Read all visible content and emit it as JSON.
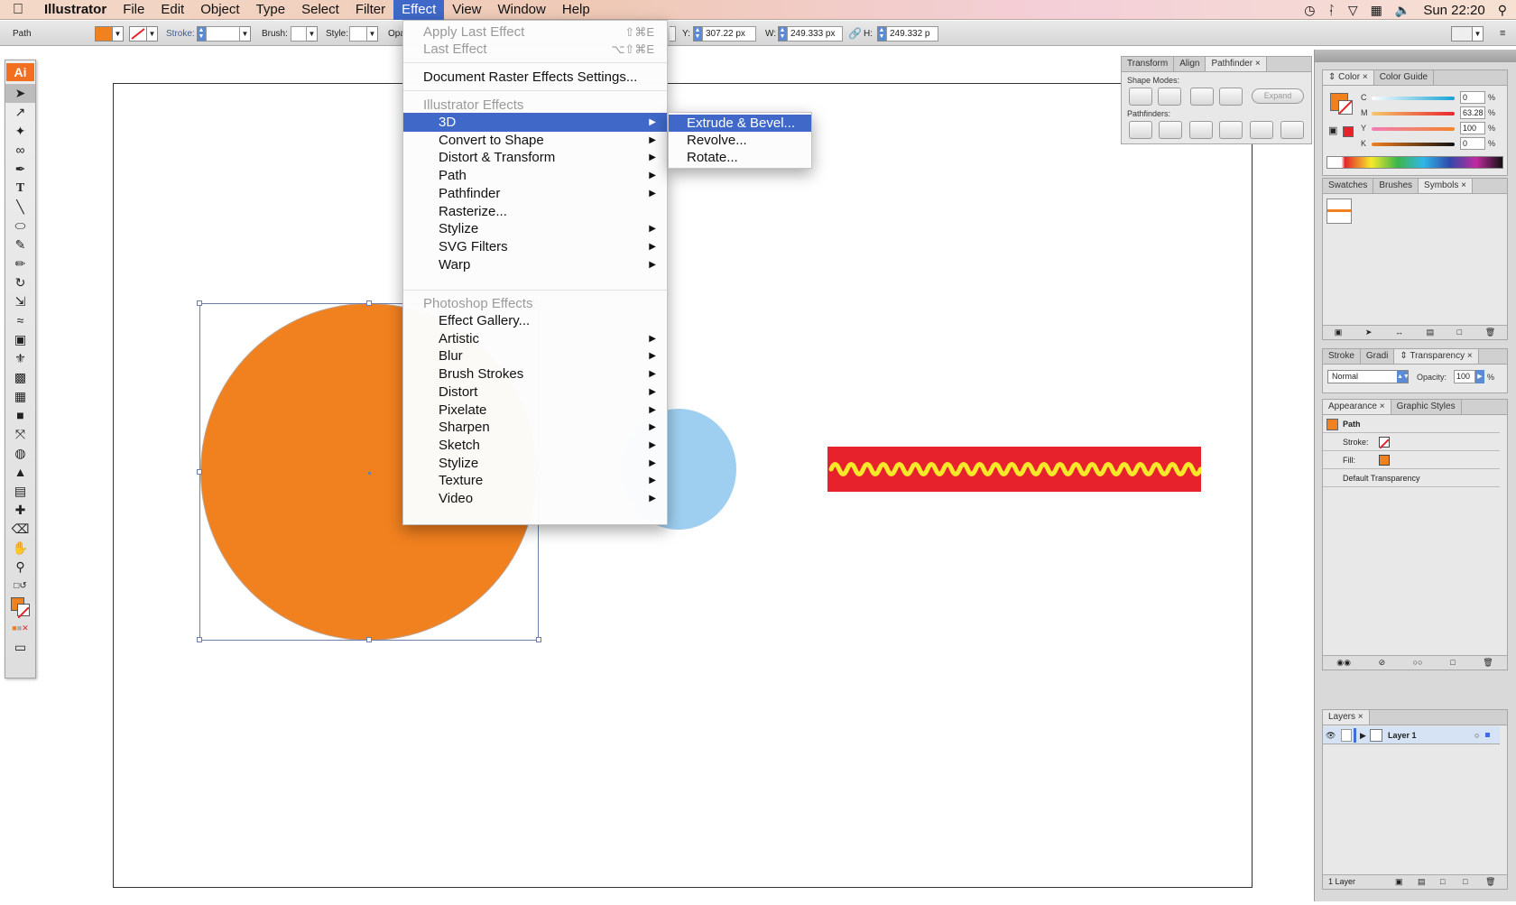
{
  "menubar": {
    "app_name": "Illustrator",
    "items": [
      "File",
      "Edit",
      "Object",
      "Type",
      "Select",
      "Filter",
      "Effect",
      "View",
      "Window",
      "Help"
    ],
    "active": "Effect",
    "clock": "Sun 22:20"
  },
  "control_bar": {
    "selection_label": "Path",
    "fill_color": "#f1801f",
    "stroke_label": "Stroke:",
    "brush_label": "Brush:",
    "style_label": "Style:",
    "opacity_label": "Opa",
    "y_label": "Y:",
    "y_value": "307.22 px",
    "w_label": "W:",
    "w_value": "249.333 px",
    "h_label": "H:",
    "h_value": "249.332 p"
  },
  "effect_menu": {
    "apply_last": "Apply Last Effect",
    "apply_last_shortcut": "⇧⌘E",
    "last_effect": "Last Effect",
    "last_effect_shortcut": "⌥⇧⌘E",
    "raster_settings": "Document Raster Effects Settings...",
    "illustrator_header": "Illustrator Effects",
    "illustrator_items": [
      "3D",
      "Convert to Shape",
      "Distort & Transform",
      "Path",
      "Pathfinder",
      "Rasterize...",
      "Stylize",
      "SVG Filters",
      "Warp"
    ],
    "photoshop_header": "Photoshop Effects",
    "photoshop_items": [
      "Effect Gallery...",
      "Artistic",
      "Blur",
      "Brush Strokes",
      "Distort",
      "Pixelate",
      "Sharpen",
      "Sketch",
      "Stylize",
      "Texture",
      "Video"
    ]
  },
  "submenu_3d": {
    "items": [
      "Extrude & Bevel...",
      "Revolve...",
      "Rotate..."
    ]
  },
  "pathfinder_panel": {
    "tabs": [
      "Transform",
      "Align",
      "Pathfinder"
    ],
    "shape_modes_label": "Shape Modes:",
    "expand_label": "Expand",
    "pathfinders_label": "Pathfinders:"
  },
  "color_panel": {
    "tabs": [
      "Color",
      "Color Guide"
    ],
    "c_label": "C",
    "c_value": "0",
    "m_label": "M",
    "m_value": "63.28",
    "y_label": "Y",
    "y_value": "100",
    "k_label": "K",
    "k_value": "0",
    "pct": "%"
  },
  "swatches_panel": {
    "tabs": [
      "Swatches",
      "Brushes",
      "Symbols"
    ]
  },
  "stroke_panel": {
    "tabs": [
      "Stroke",
      "Gradi",
      "Transparency"
    ],
    "blend_mode": "Normal",
    "opacity_label": "Opacity:",
    "opacity_value": "100",
    "pct": "%"
  },
  "appearance_panel": {
    "tabs": [
      "Appearance",
      "Graphic Styles"
    ],
    "path_label": "Path",
    "stroke_label": "Stroke:",
    "fill_label": "Fill:",
    "default_transparency": "Default Transparency"
  },
  "layers_panel": {
    "tabs": [
      "Layers"
    ],
    "layer_name": "Layer 1",
    "footer": "1 Layer"
  },
  "colors": {
    "accent": "#3f68c8",
    "orange": "#f1801f",
    "blue": "#9fcff0",
    "red": "#e8222c",
    "yellow": "#f7e92a"
  }
}
